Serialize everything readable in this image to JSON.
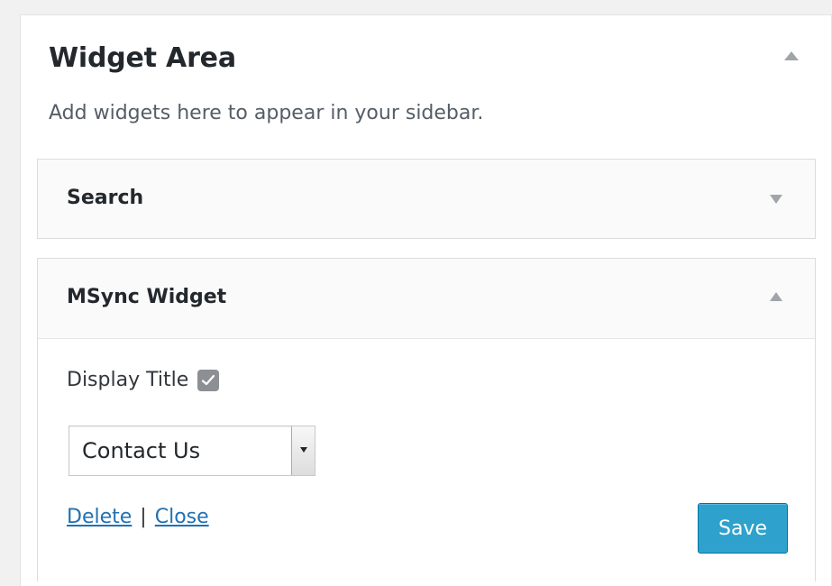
{
  "widget_area": {
    "title": "Widget Area",
    "description": "Add widgets here to appear in your sidebar."
  },
  "widgets": [
    {
      "title": "Search",
      "expanded": false
    },
    {
      "title": "MSync Widget",
      "expanded": true,
      "display_title_label": "Display Title",
      "display_title_checked": true,
      "select_value": "Contact Us",
      "delete_label": "Delete",
      "separator": "|",
      "close_label": "Close",
      "save_label": "Save"
    }
  ],
  "icons": {
    "area_toggle": "triangle-up-icon",
    "search_toggle": "triangle-down-icon",
    "msync_toggle": "triangle-up-icon",
    "checkbox": "checkmark-icon",
    "select_arrow": "chevron-down-icon"
  },
  "colors": {
    "accent": "#2ea2cc",
    "link": "#2271b1",
    "checkbox": "#8c8f94"
  }
}
